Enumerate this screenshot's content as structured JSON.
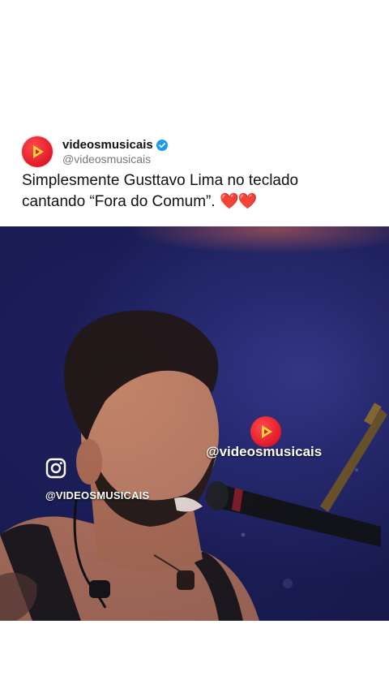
{
  "post": {
    "display_name": "videosmusicais",
    "handle": "@videosmusicais",
    "text": "Simplesmente Gusttavo Lima no teclado cantando “Fora do Comum”.",
    "hearts": "❤️❤️",
    "verified_icon": "verified-badge-icon",
    "avatar_icon": "play-logo-icon"
  },
  "video": {
    "overlay_handle": "@videosmusicais",
    "instagram_handle": "@VIDEOSMUSICAIS",
    "logo_icon": "play-logo-icon",
    "instagram_icon": "instagram-icon"
  },
  "colors": {
    "brand_red": "#e0182a",
    "verified_blue": "#1d9bf0",
    "stage_blue": "#2a2d78"
  }
}
